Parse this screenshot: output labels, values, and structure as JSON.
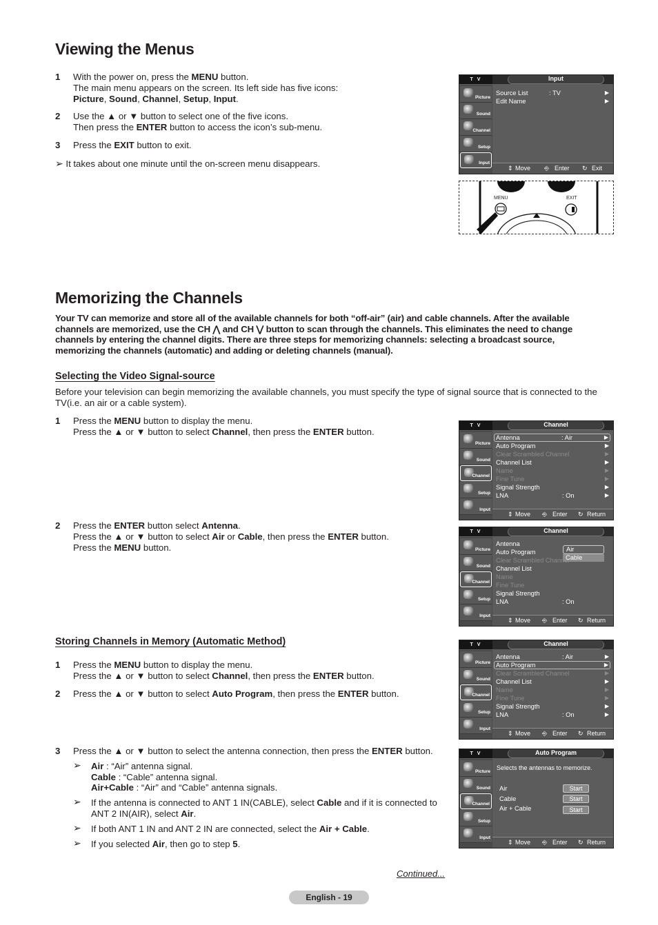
{
  "section1": {
    "title": "Viewing the Menus",
    "steps": [
      {
        "num": "1",
        "html": "With the power on, press the <b>MENU</b> button.<br>The main menu appears on the screen. Its left side has five icons:<br><b>Picture</b>, <b>Sound</b>, <b>Channel</b>, <b>Setup</b>, <b>Input</b>."
      },
      {
        "num": "2",
        "html": "Use the ▲ or ▼ button to select one of the five icons.<br>Then press the <b>ENTER</b> button to access the icon’s sub-menu."
      },
      {
        "num": "3",
        "html": "Press the <b>EXIT</b> button to exit."
      }
    ],
    "note": "It takes about one minute until the on-screen menu disappears."
  },
  "section2": {
    "title": "Memorizing the Channels",
    "intro": "Your TV can memorize and store all of the available channels for both “off-air” (air) and cable channels. After the available channels are memorized, use the CH ⋀ and CH ⋁ button to scan through the channels. This eliminates the need to change channels by entering the channel digits. There are three steps for memorizing channels: selecting a broadcast source, memorizing the channels (automatic) and adding or deleting channels (manual).",
    "sub1": {
      "heading": "Selecting the Video Signal-source",
      "body": "Before your television can begin memorizing the available channels, you must specify the type of signal source that is connected to the TV(i.e. an air or a cable system).",
      "steps": [
        {
          "num": "1",
          "html": "Press the <b>MENU</b> button to display the menu.<br>Press the ▲ or ▼ button to select <b>Channel</b>, then press the <b>ENTER</b> button."
        },
        {
          "num": "2",
          "html": "Press the <b>ENTER</b> button select <b>Antenna</b>.<br>Press the ▲ or ▼ button to select <b>Air</b> or <b>Cable</b>, then press the <b>ENTER</b> button.<br>Press the <b>MENU</b> button."
        }
      ]
    },
    "sub2": {
      "heading": "Storing Channels in Memory (Automatic Method)",
      "steps": [
        {
          "num": "1",
          "html": "Press the <b>MENU</b> button to display the menu.<br>Press the ▲ or ▼ button to select <b>Channel</b>, then press the <b>ENTER</b> button."
        },
        {
          "num": "2",
          "html": "Press the ▲ or ▼ button to select <b>Auto Program</b>, then press the <b>ENTER</b> button."
        },
        {
          "num": "3",
          "html": "Press the ▲ or ▼ button to select the antenna connection, then press the <b>ENTER</b> button."
        }
      ],
      "notes": [
        "<b>Air</b> : “Air” antenna signal.<br><b>Cable</b> : “Cable” antenna signal.<br><b>Air+Cable</b> : “Air” and “Cable” antenna signals.",
        "If the antenna is connected to ANT 1 IN(CABLE), select <b>Cable</b> and if it is connected to ANT 2 IN(AIR), select <b>Air</b>.",
        "If both ANT 1 IN and ANT 2 IN are connected, select the <b>Air + Cable</b>.",
        "If you selected <b>Air</b>, then go to step <b>5</b>."
      ]
    }
  },
  "osd_common": {
    "tv_label": "T V",
    "side_icons": [
      "Picture",
      "Sound",
      "Channel",
      "Setup",
      "Input"
    ],
    "foot_move": "Move",
    "foot_enter": "Enter",
    "foot_exit": "Exit",
    "foot_return": "Return"
  },
  "osd_input": {
    "title": "Input",
    "rows": [
      {
        "label": "Source List",
        "value": ": TV"
      },
      {
        "label": "Edit Name",
        "value": ""
      }
    ]
  },
  "osd_channel": {
    "title": "Channel",
    "rows": [
      {
        "label": "Antenna",
        "value": ": Air",
        "disabled": false
      },
      {
        "label": "Auto Program",
        "value": "",
        "disabled": false
      },
      {
        "label": "Clear Scrambled Channel",
        "value": "",
        "disabled": true
      },
      {
        "label": "Channel List",
        "value": "",
        "disabled": false
      },
      {
        "label": "Name",
        "value": "",
        "disabled": true
      },
      {
        "label": "Fine Tune",
        "value": "",
        "disabled": true
      },
      {
        "label": "Signal Strength",
        "value": "",
        "disabled": false
      },
      {
        "label": "LNA",
        "value": ": On",
        "disabled": false
      }
    ],
    "dropdown": [
      "Air",
      "Cable"
    ]
  },
  "osd_auto": {
    "title": "Auto Program",
    "desc": "Selects the antennas to memorize.",
    "options": [
      "Air",
      "Cable",
      "Air + Cable"
    ],
    "button": "Start"
  },
  "remote": {
    "menu_label": "MENU",
    "exit_label": "EXIT"
  },
  "footer": {
    "continued": "Continued...",
    "page": "English - 19"
  }
}
